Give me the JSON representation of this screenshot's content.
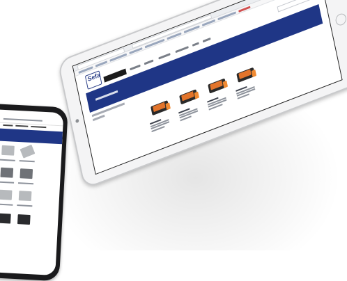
{
  "scene": {
    "description_tags": [
      "tablet-mockup",
      "phone-mockup"
    ],
    "brand_color": "#1f3686",
    "accent_color": "#e2742b"
  },
  "tablet": {
    "logo_text": "Sefa",
    "product_count": 4,
    "description_count": 4
  },
  "phone": {
    "tile_rows": 5
  }
}
